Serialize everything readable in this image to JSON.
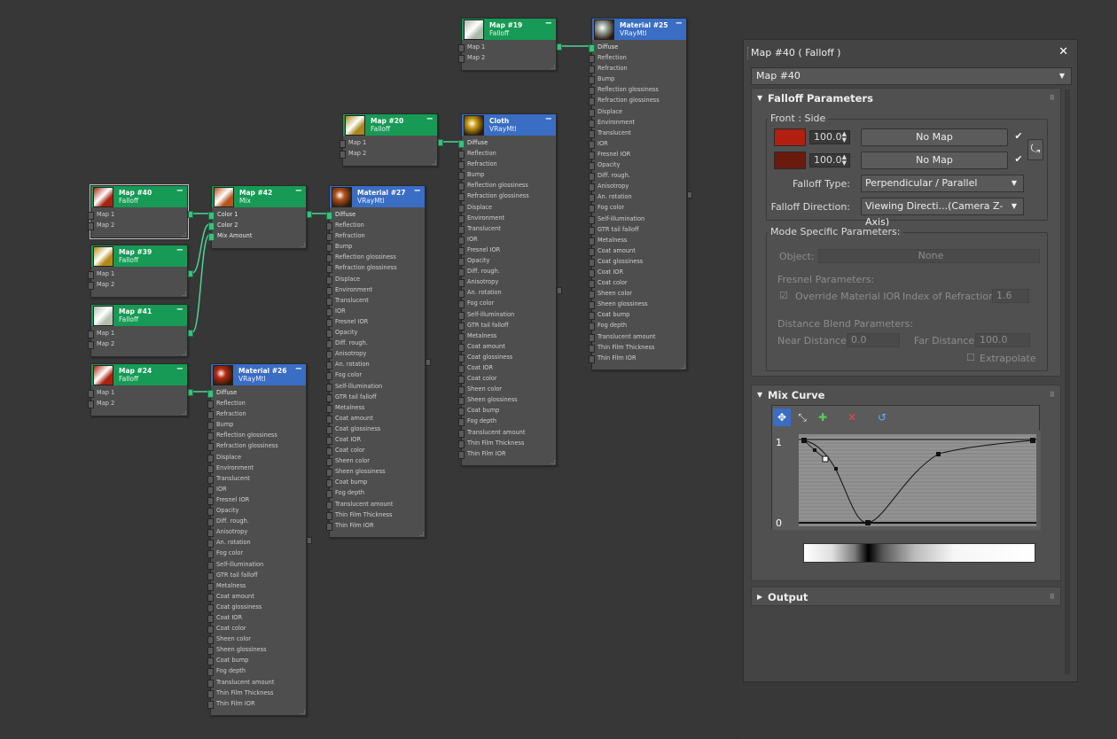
{
  "nodes": {
    "map19": {
      "title": "Map #19",
      "type": "Falloff",
      "slots": [
        "Map 1",
        "Map 2"
      ]
    },
    "mat25": {
      "title": "Material #25",
      "type": "VRayMtl"
    },
    "map20": {
      "title": "Map #20",
      "type": "Falloff",
      "slots": [
        "Map 1",
        "Map 2"
      ]
    },
    "cloth": {
      "title": "Cloth",
      "type": "VRayMtl"
    },
    "map40": {
      "title": "Map #40",
      "type": "Falloff",
      "slots": [
        "Map 1",
        "Map 2"
      ]
    },
    "map42": {
      "title": "Map #42",
      "type": "Mix",
      "slots": [
        "Color 1",
        "Color 2",
        "Mix Amount"
      ]
    },
    "mat27": {
      "title": "Material #27",
      "type": "VRayMtl"
    },
    "map39": {
      "title": "Map #39",
      "type": "Falloff",
      "slots": [
        "Map 1",
        "Map 2"
      ]
    },
    "map41": {
      "title": "Map #41",
      "type": "Falloff",
      "slots": [
        "Map 1",
        "Map 2"
      ]
    },
    "map24": {
      "title": "Map #24",
      "type": "Falloff",
      "slots": [
        "Map 1",
        "Map 2"
      ]
    },
    "mat26": {
      "title": "Material #26",
      "type": "VRayMtl"
    }
  },
  "vray_slots": [
    "Diffuse",
    "Reflection",
    "Refraction",
    "Bump",
    "Reflection glossiness",
    "Refraction glossiness",
    "Displace",
    "Environment",
    "Translucent",
    "IOR",
    "Fresnel IOR",
    "Opacity",
    "Diff. rough.",
    "Anisotropy",
    "An. rotation",
    "Fog color",
    "Self-illumination",
    "GTR tail falloff",
    "Metalness",
    "Coat amount",
    "Coat glossiness",
    "Coat IOR",
    "Coat color",
    "Sheen color",
    "Sheen glossiness",
    "Coat bump",
    "Fog depth",
    "Translucent amount",
    "Thin Film Thickness",
    "Thin Film IOR"
  ],
  "minus_glyph": "−",
  "panel": {
    "title": "Map #40  ( Falloff )",
    "close_icon": "✕",
    "map_name": "Map #40",
    "falloff": {
      "header": "Falloff Parameters",
      "group": "Front : Side",
      "row1": {
        "color": "#b21e10",
        "amount": "100.0",
        "map": "No Map",
        "checked": true
      },
      "row2": {
        "color": "#6b1a0e",
        "amount": "100.0",
        "map": "No Map",
        "checked": true
      },
      "type_label": "Falloff Type:",
      "type_value": "Perpendicular / Parallel",
      "dir_label": "Falloff Direction:",
      "dir_value": "Viewing Directi...(Camera Z-Axis)"
    },
    "mode": {
      "group": "Mode Specific Parameters:",
      "object_label": "Object:",
      "object_value": "None",
      "fresnel_label": "Fresnel Parameters:",
      "override_label": "Override Material IOR",
      "ior_label": "Index of Refraction",
      "ior_value": "1.6",
      "distance_label": "Distance Blend Parameters:",
      "near_label": "Near Distance:",
      "near_value": "0.0",
      "far_label": "Far Distance:",
      "far_value": "100.0",
      "extrapolate_label": "Extrapolate"
    },
    "mix": {
      "header": "Mix Curve",
      "y_top": "1",
      "y_bottom": "0"
    },
    "output": {
      "header": "Output"
    }
  }
}
